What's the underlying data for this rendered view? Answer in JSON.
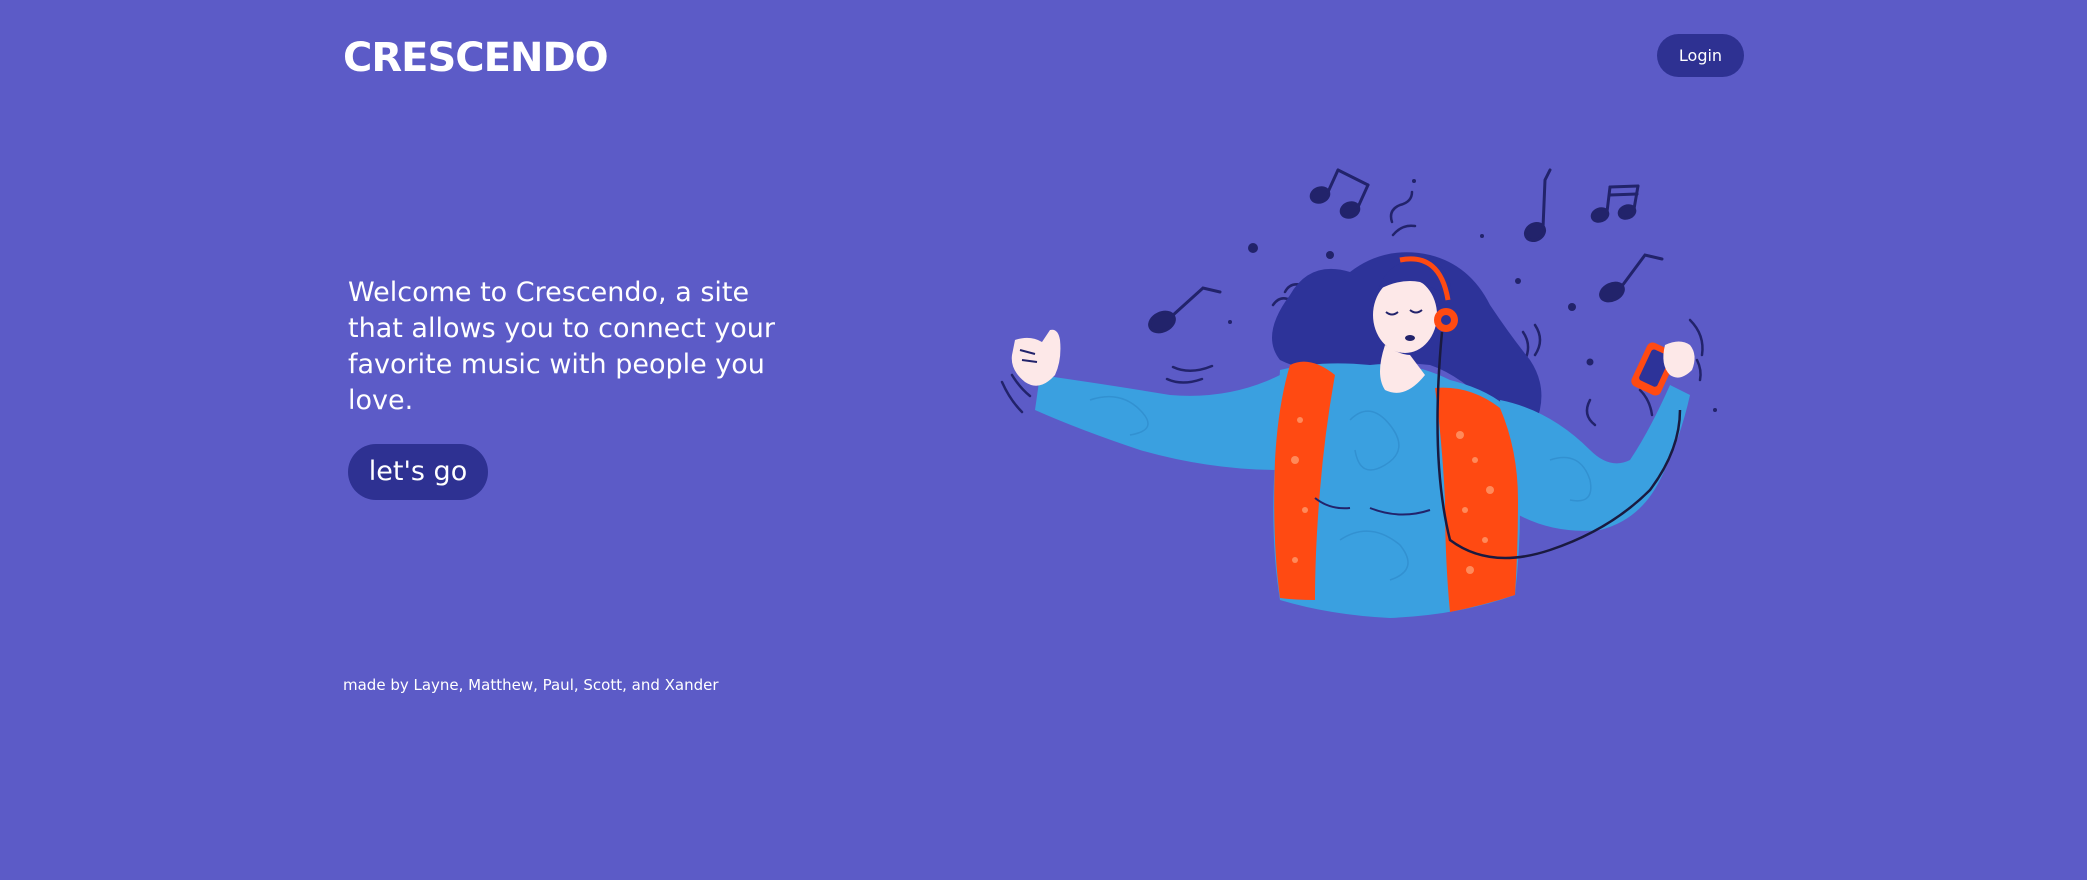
{
  "header": {
    "brand": "CRESCENDO",
    "login_label": "Login"
  },
  "hero": {
    "text": "Welcome to Crescendo, a site that allows you to connect your favorite music with people you love.",
    "cta_label": "let's go"
  },
  "footer": {
    "credits": "made by Layne, Matthew, Paul, Scott, and Xander"
  },
  "illustration": {
    "icon": "woman-listening-music-illustration"
  },
  "colors": {
    "background": "#5c5bc7",
    "button": "#2e3192",
    "text": "#ffffff",
    "shirt": "#3aa0e0",
    "vest": "#ff4a12",
    "hair": "#2d3399",
    "skin": "#fde8e8",
    "notes": "#22236b"
  }
}
